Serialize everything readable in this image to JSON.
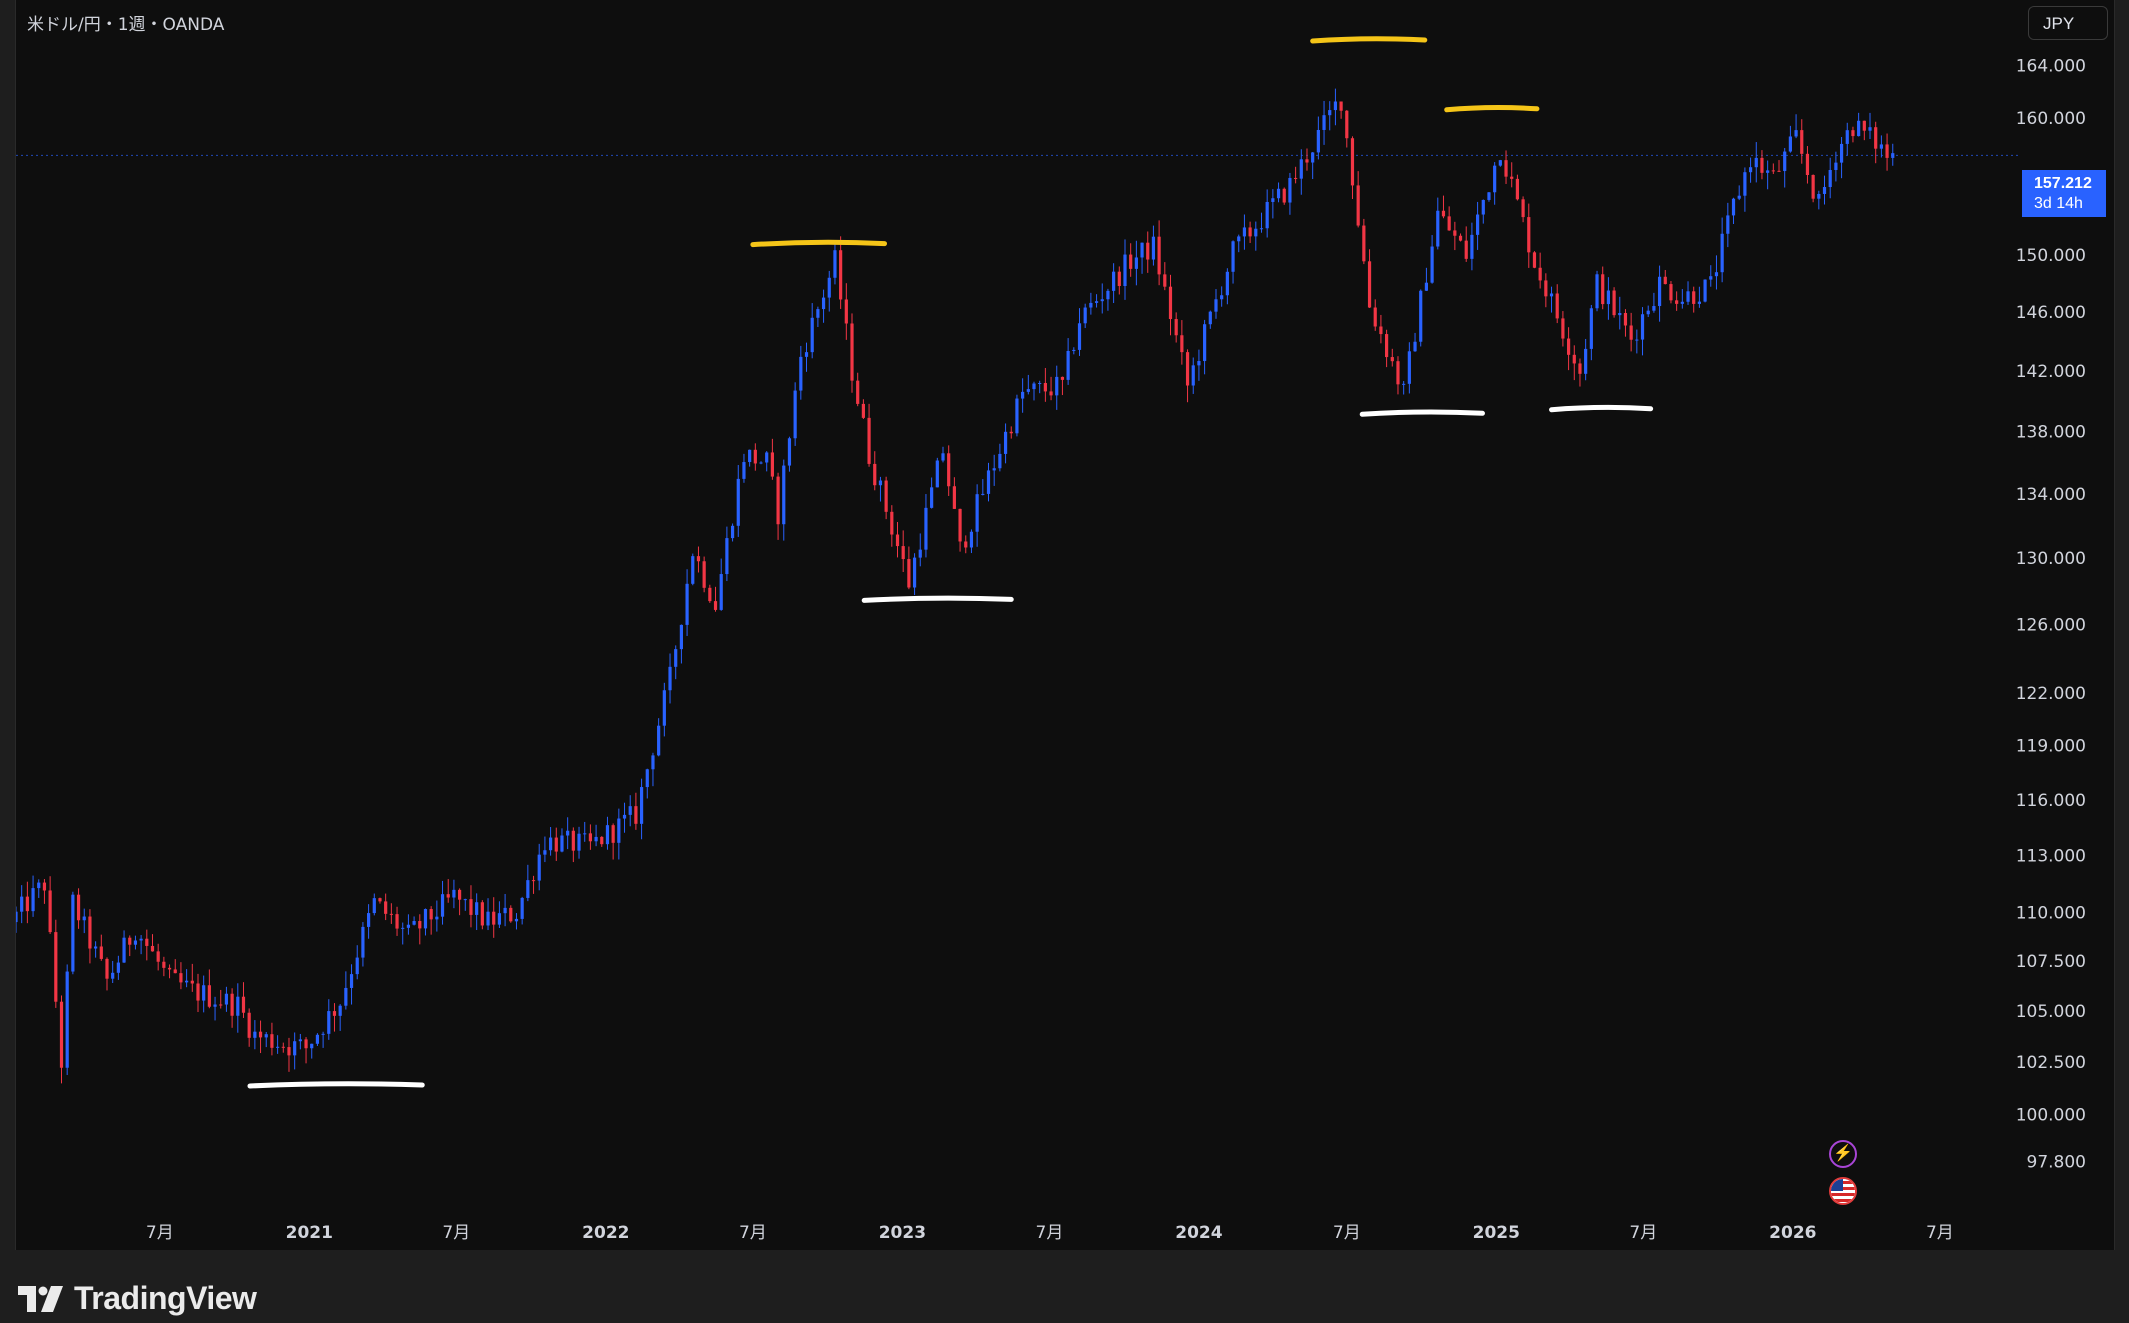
{
  "header": {
    "symbol_title": "米ドル/円・1週・OANDA",
    "currency_button": "JPY"
  },
  "price_tag": {
    "price": "157.212",
    "countdown": "3d 14h"
  },
  "footer": {
    "brand": "TradingView"
  },
  "icons": {
    "events": [
      "lightning-icon",
      "us-flag-icon"
    ]
  },
  "colors": {
    "background": "#0e0e0e",
    "up_candle": "#2962ff",
    "down_candle": "#f23645",
    "price_tag": "#2962ff",
    "resistance_mark": "#f5c518",
    "support_mark": "#ffffff"
  },
  "chart_data": {
    "type": "candlestick",
    "title": "米ドル/円・1週・OANDA",
    "y_scale": "log",
    "ylim": [
      96.5,
      166
    ],
    "y_ticks": [
      "164.000",
      "160.000",
      "150.000",
      "146.000",
      "142.000",
      "138.000",
      "134.000",
      "130.000",
      "126.000",
      "122.000",
      "119.000",
      "116.000",
      "113.000",
      "110.000",
      "107.500",
      "105.000",
      "102.500",
      "100.000",
      "97.800"
    ],
    "x_ticks": [
      {
        "label": "7月",
        "date": "2020-07-01"
      },
      {
        "label": "2021",
        "date": "2021-01-01"
      },
      {
        "label": "7月",
        "date": "2021-07-01"
      },
      {
        "label": "2022",
        "date": "2022-01-01"
      },
      {
        "label": "7月",
        "date": "2022-07-01"
      },
      {
        "label": "2023",
        "date": "2023-01-01"
      },
      {
        "label": "7月",
        "date": "2023-07-01"
      },
      {
        "label": "2024",
        "date": "2024-01-01"
      },
      {
        "label": "7月",
        "date": "2024-07-01"
      },
      {
        "label": "2025",
        "date": "2025-01-01"
      },
      {
        "label": "7月",
        "date": "2025-07-01"
      },
      {
        "label": "2026",
        "date": "2026-01-01"
      },
      {
        "label": "7月",
        "date": "2026-07-01"
      }
    ],
    "xlim": [
      "2020-01-06",
      "2026-10-15"
    ],
    "current_price": 157.212,
    "path_anchors": [
      [
        "2020-01-06",
        109.5
      ],
      [
        "2020-02-17",
        111.5
      ],
      [
        "2020-03-09",
        102.5
      ],
      [
        "2020-03-23",
        110.5
      ],
      [
        "2020-05-04",
        106.5
      ],
      [
        "2020-06-08",
        109.2
      ],
      [
        "2020-07-20",
        106.5
      ],
      [
        "2020-08-17",
        106.0
      ],
      [
        "2020-10-12",
        105.3
      ],
      [
        "2020-11-02",
        103.8
      ],
      [
        "2020-12-14",
        103.3
      ],
      [
        "2021-01-04",
        103.2
      ],
      [
        "2021-02-15",
        105.5
      ],
      [
        "2021-03-29",
        110.5
      ],
      [
        "2021-05-10",
        108.8
      ],
      [
        "2021-07-05",
        110.8
      ],
      [
        "2021-08-16",
        109.5
      ],
      [
        "2021-09-20",
        110.0
      ],
      [
        "2021-10-25",
        113.8
      ],
      [
        "2021-12-20",
        113.5
      ],
      [
        "2022-02-14",
        115.2
      ],
      [
        "2022-03-28",
        122.8
      ],
      [
        "2022-04-25",
        130.5
      ],
      [
        "2022-05-23",
        127.2
      ],
      [
        "2022-06-27",
        136.5
      ],
      [
        "2022-07-25",
        136.0
      ],
      [
        "2022-08-08",
        132.8
      ],
      [
        "2022-09-05",
        143.0
      ],
      [
        "2022-10-17",
        149.5
      ],
      [
        "2022-11-07",
        142.0
      ],
      [
        "2022-11-28",
        136.5
      ],
      [
        "2023-01-16",
        128.5
      ],
      [
        "2023-02-27",
        136.8
      ],
      [
        "2023-03-20",
        130.5
      ],
      [
        "2023-06-05",
        140.5
      ],
      [
        "2023-07-24",
        141.0
      ],
      [
        "2023-08-14",
        145.5
      ],
      [
        "2023-10-16",
        149.6
      ],
      [
        "2023-11-13",
        150.6
      ],
      [
        "2023-12-25",
        141.0
      ],
      [
        "2024-02-19",
        150.2
      ],
      [
        "2024-04-29",
        155.0
      ],
      [
        "2024-06-24",
        160.9
      ],
      [
        "2024-07-01",
        161.5
      ],
      [
        "2024-08-05",
        146.5
      ],
      [
        "2024-09-16",
        140.5
      ],
      [
        "2024-10-28",
        153.0
      ],
      [
        "2024-12-02",
        150.0
      ],
      [
        "2025-01-13",
        157.8
      ],
      [
        "2025-02-24",
        149.5
      ],
      [
        "2025-04-21",
        142.0
      ],
      [
        "2025-05-12",
        148.0
      ],
      [
        "2025-06-23",
        144.2
      ],
      [
        "2025-07-28",
        148.0
      ],
      [
        "2025-08-25",
        147.0
      ],
      [
        "2025-09-29",
        147.8
      ],
      [
        "2025-10-27",
        153.5
      ],
      [
        "2025-11-17",
        157.0
      ],
      [
        "2025-12-15",
        155.5
      ],
      [
        "2026-01-12",
        158.5
      ],
      [
        "2026-02-09",
        153.5
      ],
      [
        "2026-03-02",
        157.5
      ],
      [
        "2026-03-23",
        159.5
      ],
      [
        "2026-04-20",
        158.2
      ],
      [
        "2026-05-04",
        157.2
      ]
    ],
    "annotations": [
      {
        "type": "resistance",
        "color": "#f5c518",
        "date_range": [
          "2022-07-01",
          "2022-12-10"
        ],
        "price": 150.8
      },
      {
        "type": "resistance",
        "color": "#f5c518",
        "date_range": [
          "2024-05-20",
          "2024-10-05"
        ],
        "price": 166.0
      },
      {
        "type": "resistance",
        "color": "#f5c518",
        "date_range": [
          "2024-11-01",
          "2025-02-20"
        ],
        "price": 160.7
      },
      {
        "type": "support",
        "color": "#ffffff",
        "date_range": [
          "2020-10-20",
          "2021-05-20"
        ],
        "price": 101.4
      },
      {
        "type": "support",
        "color": "#ffffff",
        "date_range": [
          "2022-11-15",
          "2023-05-15"
        ],
        "price": 127.5
      },
      {
        "type": "support",
        "color": "#ffffff",
        "date_range": [
          "2024-07-20",
          "2024-12-15"
        ],
        "price": 139.2
      },
      {
        "type": "support",
        "color": "#ffffff",
        "date_range": [
          "2025-03-10",
          "2025-07-10"
        ],
        "price": 139.5
      }
    ]
  }
}
